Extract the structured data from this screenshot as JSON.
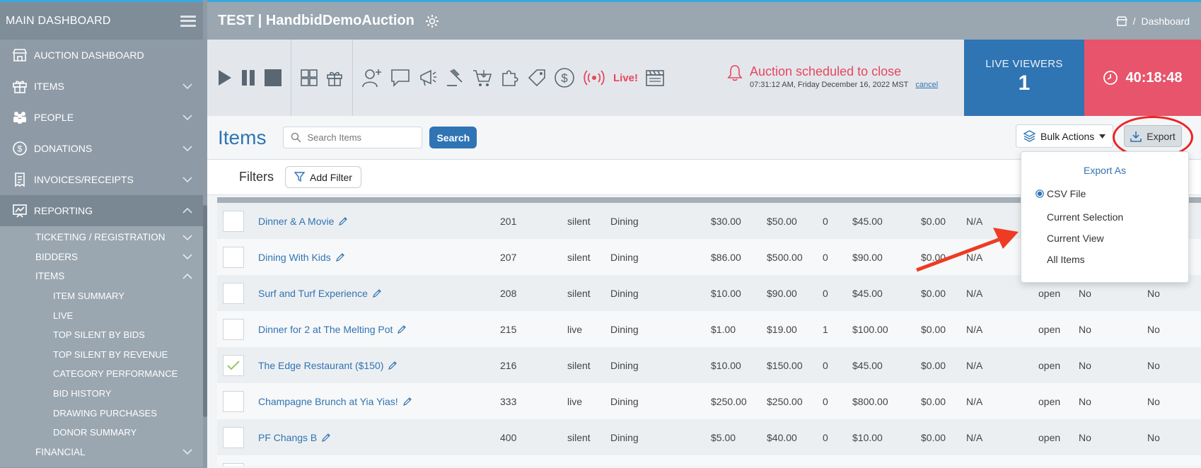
{
  "sidebar": {
    "title": "MAIN DASHBOARD",
    "items": [
      {
        "label": "AUCTION DASHBOARD",
        "icon": "store-icon"
      },
      {
        "label": "ITEMS",
        "icon": "gift-icon"
      },
      {
        "label": "PEOPLE",
        "icon": "people-icon"
      },
      {
        "label": "DONATIONS",
        "icon": "dollar-icon"
      },
      {
        "label": "INVOICES/RECEIPTS",
        "icon": "receipt-icon"
      },
      {
        "label": "REPORTING",
        "icon": "chart-icon"
      }
    ],
    "reporting_sub": [
      {
        "label": "TICKETING / REGISTRATION"
      },
      {
        "label": "BIDDERS"
      },
      {
        "label": "ITEMS"
      }
    ],
    "items_sub": [
      {
        "label": "ITEM SUMMARY"
      },
      {
        "label": "LIVE"
      },
      {
        "label": "TOP SILENT BY BIDS"
      },
      {
        "label": "TOP SILENT BY REVENUE"
      },
      {
        "label": "CATEGORY PERFORMANCE"
      },
      {
        "label": "BID HISTORY"
      },
      {
        "label": "DRAWING PURCHASES"
      },
      {
        "label": "DONOR SUMMARY"
      }
    ],
    "financial": "FINANCIAL"
  },
  "header": {
    "title": "TEST | HandbidDemoAuction",
    "breadcrumb_sep": "/",
    "breadcrumb": "Dashboard"
  },
  "toolbar": {
    "live_label": "Live!",
    "notice_title": "Auction scheduled to close",
    "notice_time": "07:31:12 AM, Friday December 16, 2022 MST",
    "notice_cancel": "cancel",
    "viewers_label": "LIVE VIEWERS",
    "viewers_count": "1",
    "timer": "40:18:48",
    "accent_red": "#e8465e",
    "accent_blue": "#2f74b3"
  },
  "items": {
    "title": "Items",
    "search_placeholder": "Search Items",
    "search_button": "Search",
    "bulk_actions": "Bulk Actions",
    "export": "Export",
    "filters_label": "Filters",
    "add_filter": "Add Filter"
  },
  "export_menu": {
    "title": "Export As",
    "format": "CSV File",
    "options": [
      "Current Selection",
      "Current View",
      "All Items"
    ]
  },
  "rows": [
    {
      "name": "Dinner & A Movie",
      "num": "201",
      "type": "silent",
      "cat": "Dining",
      "v1": "$30.00",
      "v2": "$50.00",
      "bids": "0",
      "v3": "$45.00",
      "v4": "$0.00",
      "na": "N/A",
      "status": "",
      "s1": "",
      "s2": "",
      "checked": false
    },
    {
      "name": "Dining With Kids",
      "num": "207",
      "type": "silent",
      "cat": "Dining",
      "v1": "$86.00",
      "v2": "$500.00",
      "bids": "0",
      "v3": "$90.00",
      "v4": "$0.00",
      "na": "N/A",
      "status": "",
      "s1": "",
      "s2": "",
      "checked": false
    },
    {
      "name": "Surf and Turf Experience",
      "num": "208",
      "type": "silent",
      "cat": "Dining",
      "v1": "$10.00",
      "v2": "$90.00",
      "bids": "0",
      "v3": "$45.00",
      "v4": "$0.00",
      "na": "N/A",
      "status": "open",
      "s1": "No",
      "s2": "No",
      "checked": false
    },
    {
      "name": "Dinner for 2 at The Melting Pot",
      "num": "215",
      "type": "live",
      "cat": "Dining",
      "v1": "$1.00",
      "v2": "$19.00",
      "bids": "1",
      "v3": "$100.00",
      "v4": "$0.00",
      "na": "N/A",
      "status": "open",
      "s1": "No",
      "s2": "No",
      "checked": false
    },
    {
      "name": "The Edge Restaurant ($150)",
      "num": "216",
      "type": "silent",
      "cat": "Dining",
      "v1": "$10.00",
      "v2": "$150.00",
      "bids": "0",
      "v3": "$45.00",
      "v4": "$0.00",
      "na": "N/A",
      "status": "open",
      "s1": "No",
      "s2": "No",
      "checked": true
    },
    {
      "name": "Champagne Brunch at Yia Yias!",
      "num": "333",
      "type": "live",
      "cat": "Dining",
      "v1": "$250.00",
      "v2": "$250.00",
      "bids": "0",
      "v3": "$800.00",
      "v4": "$0.00",
      "na": "N/A",
      "status": "open",
      "s1": "No",
      "s2": "No",
      "checked": false
    },
    {
      "name": "PF Changs B",
      "num": "400",
      "type": "silent",
      "cat": "Dining",
      "v1": "$5.00",
      "v2": "$40.00",
      "bids": "0",
      "v3": "$10.00",
      "v4": "$0.00",
      "na": "N/A",
      "status": "open",
      "s1": "No",
      "s2": "No",
      "checked": false
    }
  ]
}
